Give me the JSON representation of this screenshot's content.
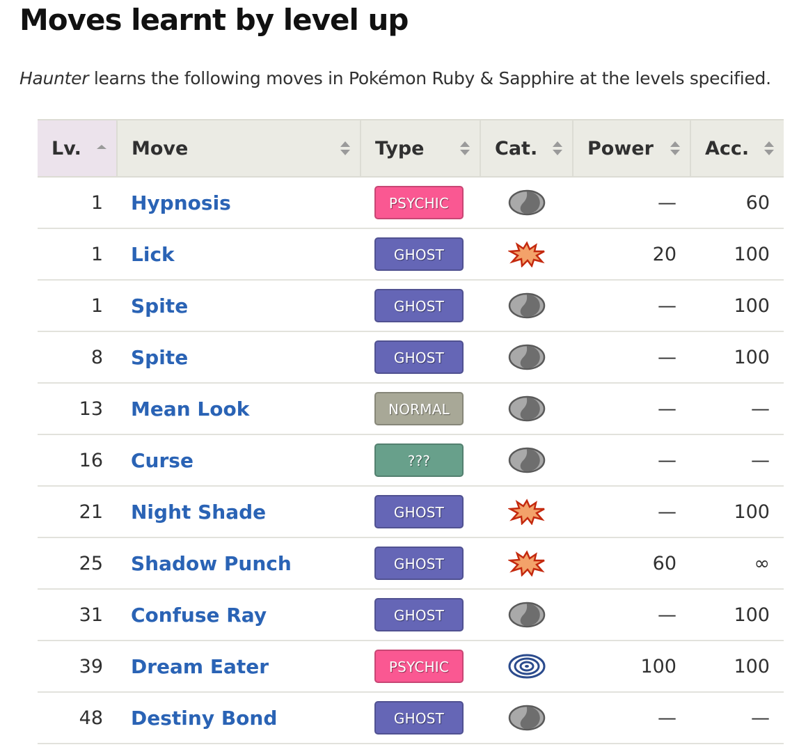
{
  "heading": "Moves learnt by level up",
  "intro": {
    "pokemon": "Haunter",
    "text": " learns the following moves in Pokémon Ruby & Sapphire at the levels specified."
  },
  "table": {
    "headers": {
      "lv": "Lv.",
      "move": "Move",
      "type": "Type",
      "cat": "Cat.",
      "power": "Power",
      "acc": "Acc."
    },
    "sorted_column": "lv",
    "type_colors": {
      "PSYCHIC": "#fa5892",
      "GHOST": "#6566b6",
      "NORMAL": "#a8a897",
      "???": "#68a08b"
    },
    "rows": [
      {
        "lv": "1",
        "move": "Hypnosis",
        "type": "PSYCHIC",
        "cat": "status-icon",
        "power": "—",
        "acc": "60"
      },
      {
        "lv": "1",
        "move": "Lick",
        "type": "GHOST",
        "cat": "physical-icon",
        "power": "20",
        "acc": "100"
      },
      {
        "lv": "1",
        "move": "Spite",
        "type": "GHOST",
        "cat": "status-icon",
        "power": "—",
        "acc": "100"
      },
      {
        "lv": "8",
        "move": "Spite",
        "type": "GHOST",
        "cat": "status-icon",
        "power": "—",
        "acc": "100"
      },
      {
        "lv": "13",
        "move": "Mean Look",
        "type": "NORMAL",
        "cat": "status-icon",
        "power": "—",
        "acc": "—"
      },
      {
        "lv": "16",
        "move": "Curse",
        "type": "???",
        "cat": "status-icon",
        "power": "—",
        "acc": "—"
      },
      {
        "lv": "21",
        "move": "Night Shade",
        "type": "GHOST",
        "cat": "physical-icon",
        "power": "—",
        "acc": "100"
      },
      {
        "lv": "25",
        "move": "Shadow Punch",
        "type": "GHOST",
        "cat": "physical-icon",
        "power": "60",
        "acc": "∞"
      },
      {
        "lv": "31",
        "move": "Confuse Ray",
        "type": "GHOST",
        "cat": "status-icon",
        "power": "—",
        "acc": "100"
      },
      {
        "lv": "39",
        "move": "Dream Eater",
        "type": "PSYCHIC",
        "cat": "special-icon",
        "power": "100",
        "acc": "100"
      },
      {
        "lv": "48",
        "move": "Destiny Bond",
        "type": "GHOST",
        "cat": "status-icon",
        "power": "—",
        "acc": "—"
      }
    ]
  }
}
